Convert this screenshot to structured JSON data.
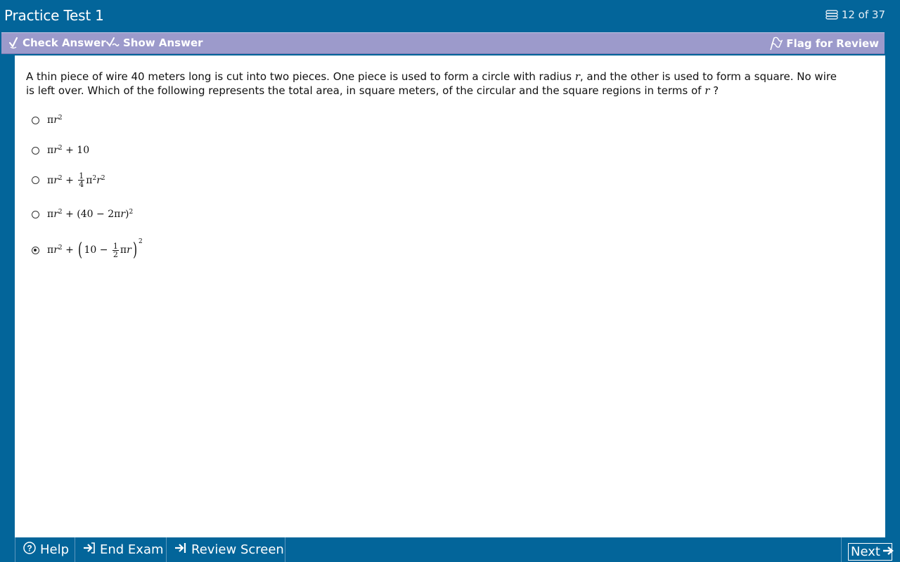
{
  "header": {
    "title": "Practice Test 1",
    "counter": "12 of 37"
  },
  "toolbar": {
    "check_answer": "Check Answer",
    "show_answer": "Show Answer",
    "flag_for_review": "Flag for Review"
  },
  "question": {
    "text_part1": "A thin piece of wire 40 meters long is cut into two pieces.  One piece is used to form a circle with radius ",
    "var_r": "r",
    "text_part2": ", and the other is used to form a square.  No wire is left over.  Which of the following represents the total area, in square meters, of the circular and the square regions in terms of ",
    "text_part3": " ?"
  },
  "choices": [
    {
      "label": "πr² ",
      "selected": false
    },
    {
      "label": "πr² + 10",
      "selected": false
    },
    {
      "label": "πr² + ¼π²r²",
      "selected": false
    },
    {
      "label": "πr² + (40 − 2πr)²",
      "selected": false
    },
    {
      "label": "πr² + (10 − ½πr)²",
      "selected": true
    }
  ],
  "math": {
    "pi": "π",
    "r": "r",
    "sq": "2",
    "plus": "+",
    "ten": "10",
    "one": "1",
    "four": "4",
    "two": "2",
    "forty_minus": "(40 − 2",
    "close_paren": ")",
    "ten_minus": "10 −",
    "open_big": "(",
    "close_big": ")"
  },
  "footer": {
    "help": "Help",
    "end_exam": "End Exam",
    "review_screen": "Review Screen",
    "next": "Next"
  }
}
